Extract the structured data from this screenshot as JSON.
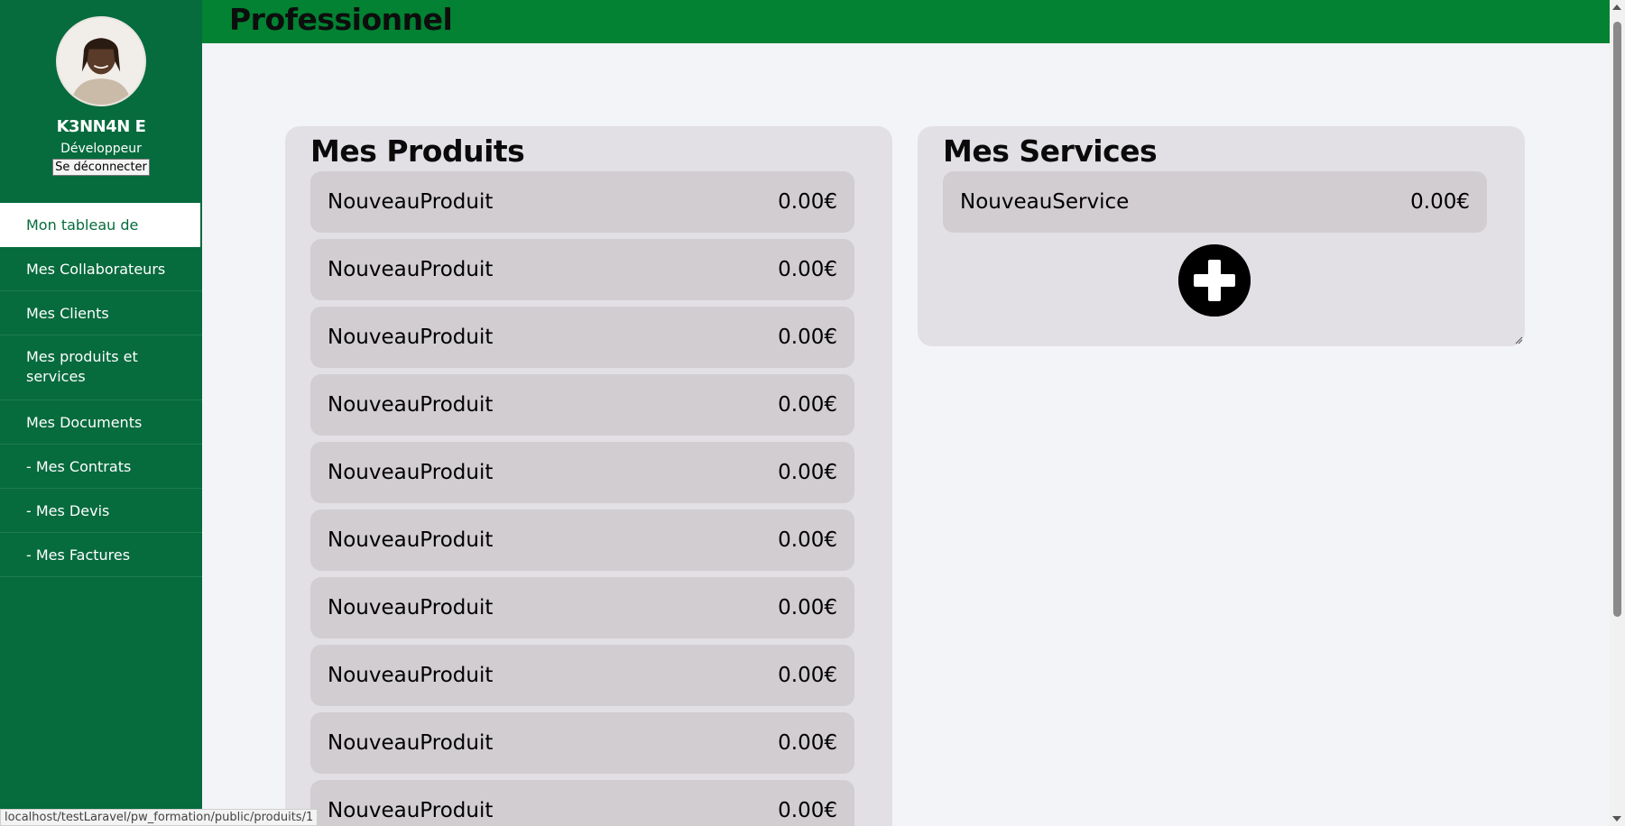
{
  "header": {
    "title": "Professionnel"
  },
  "profile": {
    "name": "K3NN4N E",
    "role": "Développeur",
    "logout_label": "Se déconnecter"
  },
  "sidebar": {
    "items": [
      {
        "label": "Mon tableau de bord",
        "active": true
      },
      {
        "label": "Mes Collaborateurs"
      },
      {
        "label": "Mes Clients"
      },
      {
        "label": "Mes produits et services"
      },
      {
        "label": "Mes Documents"
      },
      {
        "label": "- Mes Contrats"
      },
      {
        "label": "- Mes Devis"
      },
      {
        "label": "- Mes Factures"
      }
    ]
  },
  "products": {
    "title": "Mes Produits",
    "items": [
      {
        "name": "NouveauProduit",
        "price": "0.00€"
      },
      {
        "name": "NouveauProduit",
        "price": "0.00€"
      },
      {
        "name": "NouveauProduit",
        "price": "0.00€"
      },
      {
        "name": "NouveauProduit",
        "price": "0.00€"
      },
      {
        "name": "NouveauProduit",
        "price": "0.00€"
      },
      {
        "name": "NouveauProduit",
        "price": "0.00€"
      },
      {
        "name": "NouveauProduit",
        "price": "0.00€"
      },
      {
        "name": "NouveauProduit",
        "price": "0.00€"
      },
      {
        "name": "NouveauProduit",
        "price": "0.00€"
      },
      {
        "name": "NouveauProduit",
        "price": "0.00€"
      }
    ]
  },
  "services": {
    "title": "Mes Services",
    "items": [
      {
        "name": "NouveauService",
        "price": "0.00€"
      }
    ],
    "add_icon": "plus-circle-icon"
  },
  "statusbar": {
    "url": "localhost/testLaravel/pw_formation/public/produits/1"
  },
  "colors": {
    "sidebar_bg": "#066b3d",
    "header_bg": "#028232",
    "page_bg": "#f3f4f8",
    "panel_bg": "#e2e0e5",
    "item_bg": "#d1cdd1"
  }
}
